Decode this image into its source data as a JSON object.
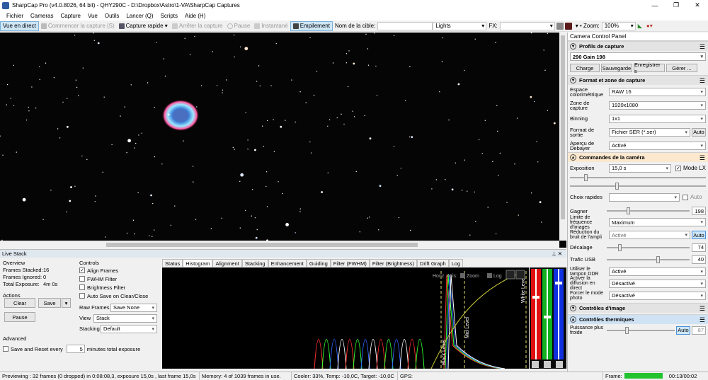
{
  "window": {
    "title": "SharpCap Pro (v4.0.8026, 64 bit) - QHY290C - D:\\Dropbox\\Astro\\1-VA\\SharpCap Captures"
  },
  "menu": [
    "Fichier",
    "Cameras",
    "Capture",
    "Vue",
    "Outils",
    "Lancer (Q)",
    "Scripts",
    "Aide (H)"
  ],
  "toolbar": {
    "live_view": "Vue en direct",
    "start_capture": "Commencer la capture (S)",
    "quick_capture": "Capture rapide",
    "stop_capture": "Arrêter la capture",
    "pause": "Pause",
    "snapshot": "Instantané",
    "stacking": "Empilement",
    "target_label": "Nom de la cible:",
    "frame_type": "Lights",
    "fx_label": "FX:",
    "zoom_label": "Zoom:",
    "zoom_value": "100%"
  },
  "ccp": {
    "title": "Camera Control Panel",
    "profiles": {
      "section": "Profils de capture",
      "selected": "290 Gain 198",
      "buttons": [
        "Charge",
        "Sauvegarde",
        "Enregistrer s",
        "Gérer ..."
      ]
    },
    "format": {
      "section": "Format et zone de capture",
      "rows": [
        {
          "label": "Espace colorimétrique",
          "value": "RAW 16"
        },
        {
          "label": "Zone de capture",
          "value": "1920x1080"
        },
        {
          "label": "Binning",
          "value": "1x1"
        },
        {
          "label": "Format de sortie",
          "value": "Fichier SER (*.ser)"
        },
        {
          "label": "Aperçu de Debayer",
          "value": "Activé"
        }
      ],
      "auto": "Auto"
    },
    "camera": {
      "section": "Commandes de la caméra",
      "exposure_label": "Exposition",
      "exposure_value": "15,0 s",
      "lx_label": "Mode LX",
      "quick_label": "Choix rapides",
      "auto": "Auto",
      "gain_label": "Gagner",
      "gain_value": "198",
      "fps_limit_label": "Limite de fréquence d'images",
      "fps_limit_value": "Maximum",
      "nr_label": "Réduction du bruit de l'ampli",
      "nr_value": "Activé",
      "offset_label": "Décalage",
      "offset_value": "74",
      "usb_label": "Trafic USB",
      "usb_value": "40",
      "ddr_label": "Utiliser le tampon DDR",
      "ddr_value": "Activé",
      "stream_label": "Activer la diffusion en direct",
      "stream_value": "Désactivé",
      "photo_label": "Forcer le mode photo",
      "photo_value": "Désactivé"
    },
    "image_controls": "Contrôles d'image",
    "thermal": {
      "section": "Contrôles thermiques",
      "power_label": "Puissance plus froide",
      "power_value": "87"
    },
    "frame_label": "Frame:"
  },
  "livestack": {
    "title": "Live Stack",
    "overview": "Overview",
    "stacked_label": "Frames Stacked:",
    "stacked_value": "16",
    "ignored_label": "Frames Ignored:",
    "ignored_value": "0",
    "exposure_label": "Total Exposure:",
    "exposure_value": "4m 0s",
    "actions": "Actions",
    "clear": "Clear",
    "save": "Save",
    "pause": "Pause",
    "advanced": "Advanced",
    "reset_label": "Save and Reset every",
    "reset_value": "5",
    "reset_suffix": "minutes total exposure",
    "controls": "Controls",
    "align": "Align Frames",
    "fwhm": "FWHM Filter",
    "brightness": "Brightness Filter",
    "autosave": "Auto Save on Clear/Close",
    "raw_label": "Raw Frames",
    "raw_value": "Save None",
    "view_label": "View",
    "view_value": "Stack",
    "stacking_label": "Stacking",
    "stacking_value": "Default",
    "tabs": [
      "Status",
      "Histogram",
      "Alignment",
      "Stacking",
      "Enhancement",
      "Guiding",
      "Filter (FWHM)",
      "Filter (Brightness)",
      "Drift Graph",
      "Log"
    ],
    "histo": {
      "horiz": "Horiz. Axis:",
      "zoom": "Zoom",
      "log": "Log",
      "black": "Black Level",
      "mid": "Mid Level",
      "white": "White Level"
    }
  },
  "status": {
    "preview": "Previewing : 32 frames (0 dropped) in 0:08:08,3, exposure 15,0s , last frame 15,0s",
    "memory": "Memory: 4 of 1039 frames in use.",
    "cooler": "Cooler: 33%, Temp: -10,0C, Target: -10,0C",
    "gps": "GPS:",
    "time": "00:13/00:02"
  },
  "colors": {
    "accent": "#0078d7",
    "frame_bar": "#22c32e"
  }
}
